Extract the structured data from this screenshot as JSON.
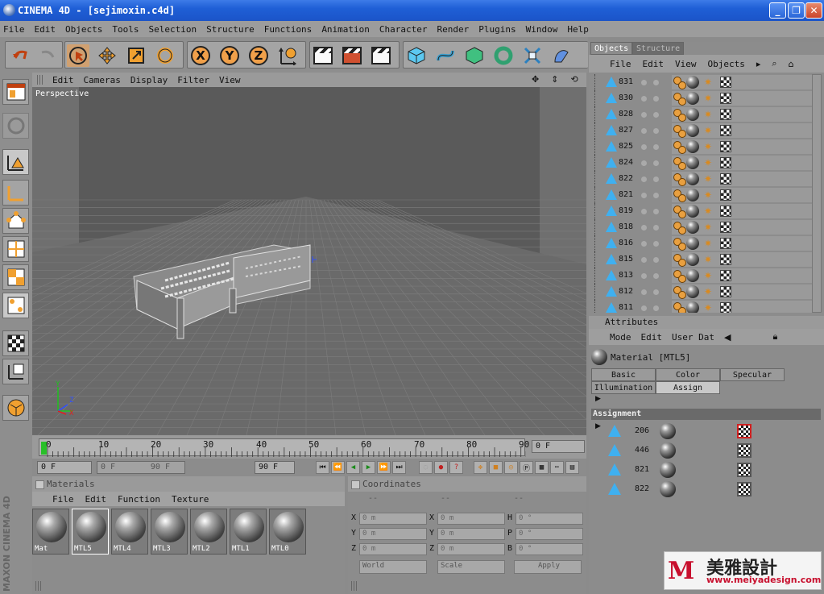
{
  "window": {
    "title": "CINEMA 4D - [sejimoxin.c4d]"
  },
  "menubar": [
    "File",
    "Edit",
    "Objects",
    "Tools",
    "Selection",
    "Structure",
    "Functions",
    "Animation",
    "Character",
    "Render",
    "Plugins",
    "Window",
    "Help"
  ],
  "viewport": {
    "menu": [
      "Edit",
      "Cameras",
      "Display",
      "Filter",
      "View"
    ],
    "label": "Perspective",
    "axes": {
      "y": "Y",
      "z": "Z",
      "x": "X"
    }
  },
  "timeline": {
    "ticks": [
      "0",
      "10",
      "20",
      "30",
      "40",
      "50",
      "60",
      "70",
      "80",
      "90"
    ],
    "current_frame": "0 F",
    "start": "0 F",
    "range_min": "0 F",
    "range_max": "90 F",
    "end": "90 F"
  },
  "materials": {
    "title": "Materials",
    "menu": [
      "File",
      "Edit",
      "Function",
      "Texture"
    ],
    "items": [
      "Mat",
      "MTL5",
      "MTL4",
      "MTL3",
      "MTL2",
      "MTL1",
      "MTL0"
    ]
  },
  "coordinates": {
    "title": "Coordinates",
    "col_headers": [
      "--",
      "--",
      "--"
    ],
    "rows": [
      {
        "a": "X",
        "av": "0 m",
        "b": "X",
        "bv": "0 m",
        "c": "H",
        "cv": "0 °"
      },
      {
        "a": "Y",
        "av": "0 m",
        "b": "Y",
        "bv": "0 m",
        "c": "P",
        "cv": "0 °"
      },
      {
        "a": "Z",
        "av": "0 m",
        "b": "Z",
        "bv": "0 m",
        "c": "B",
        "cv": "0 °"
      }
    ],
    "mode1": "World",
    "mode2": "Scale",
    "apply": "Apply"
  },
  "objects_panel": {
    "tabs": [
      "Objects",
      "Structure"
    ],
    "menu": [
      "File",
      "Edit",
      "View",
      "Objects"
    ],
    "rows": [
      "831",
      "830",
      "828",
      "827",
      "825",
      "824",
      "822",
      "821",
      "819",
      "818",
      "816",
      "815",
      "813",
      "812",
      "811"
    ]
  },
  "attributes": {
    "title": "Attributes",
    "menu": [
      "Mode",
      "Edit",
      "User Dat"
    ],
    "material_title": "Material [MTL5]",
    "tabs_row1": [
      "Basic",
      "Color",
      "Specular"
    ],
    "tabs_row2": [
      "Illumination",
      "Assign"
    ],
    "assignment_header": "Assignment",
    "assignments": [
      "206",
      "446",
      "821",
      "822"
    ]
  },
  "watermark": {
    "cn": "美雅設計",
    "url": "www.meiyadesign.com"
  },
  "maxon": "MAXON CINEMA 4D"
}
